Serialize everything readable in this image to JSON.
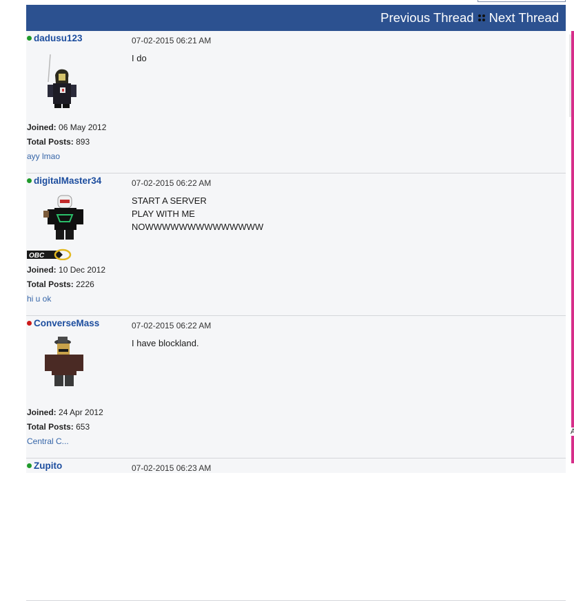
{
  "nav": {
    "previous_label": "Previous Thread",
    "next_label": "Next Thread"
  },
  "posts": [
    {
      "username": "dadusu123",
      "status": "online",
      "timestamp": "07-02-2015 06:21 AM",
      "body": [
        "I do"
      ],
      "joined_label": "Joined:",
      "joined": "06 May 2012",
      "total_posts_label": "Total Posts:",
      "total_posts": "893",
      "signature": "ayy lmao"
    },
    {
      "username": "digitalMaster34",
      "status": "online",
      "timestamp": "07-02-2015 06:22 AM",
      "body": [
        "START A SERVER",
        "PLAY WITH ME",
        "NOWWWWWWWWWWWWWW"
      ],
      "badge": "OBC",
      "joined_label": "Joined:",
      "joined": "10 Dec 2012",
      "total_posts_label": "Total Posts:",
      "total_posts": "2226",
      "signature": "hi u ok"
    },
    {
      "username": "ConverseMass",
      "status": "offline",
      "timestamp": "07-02-2015 06:22 AM",
      "body": [
        "I have blockland."
      ],
      "joined_label": "Joined:",
      "joined": "24 Apr 2012",
      "total_posts_label": "Total Posts:",
      "total_posts": "653",
      "signature": "Central C..."
    },
    {
      "username": "Zupito",
      "status": "online",
      "timestamp": "07-02-2015 06:23 AM"
    }
  ],
  "right_edge_text": "A",
  "colors": {
    "nav_bar": "#2c5190",
    "username": "#1c4d9e",
    "online": "#1f9a2a",
    "offline": "#cc1a1a",
    "signature": "#3565a8",
    "edge_accent": "#d62f8a"
  }
}
